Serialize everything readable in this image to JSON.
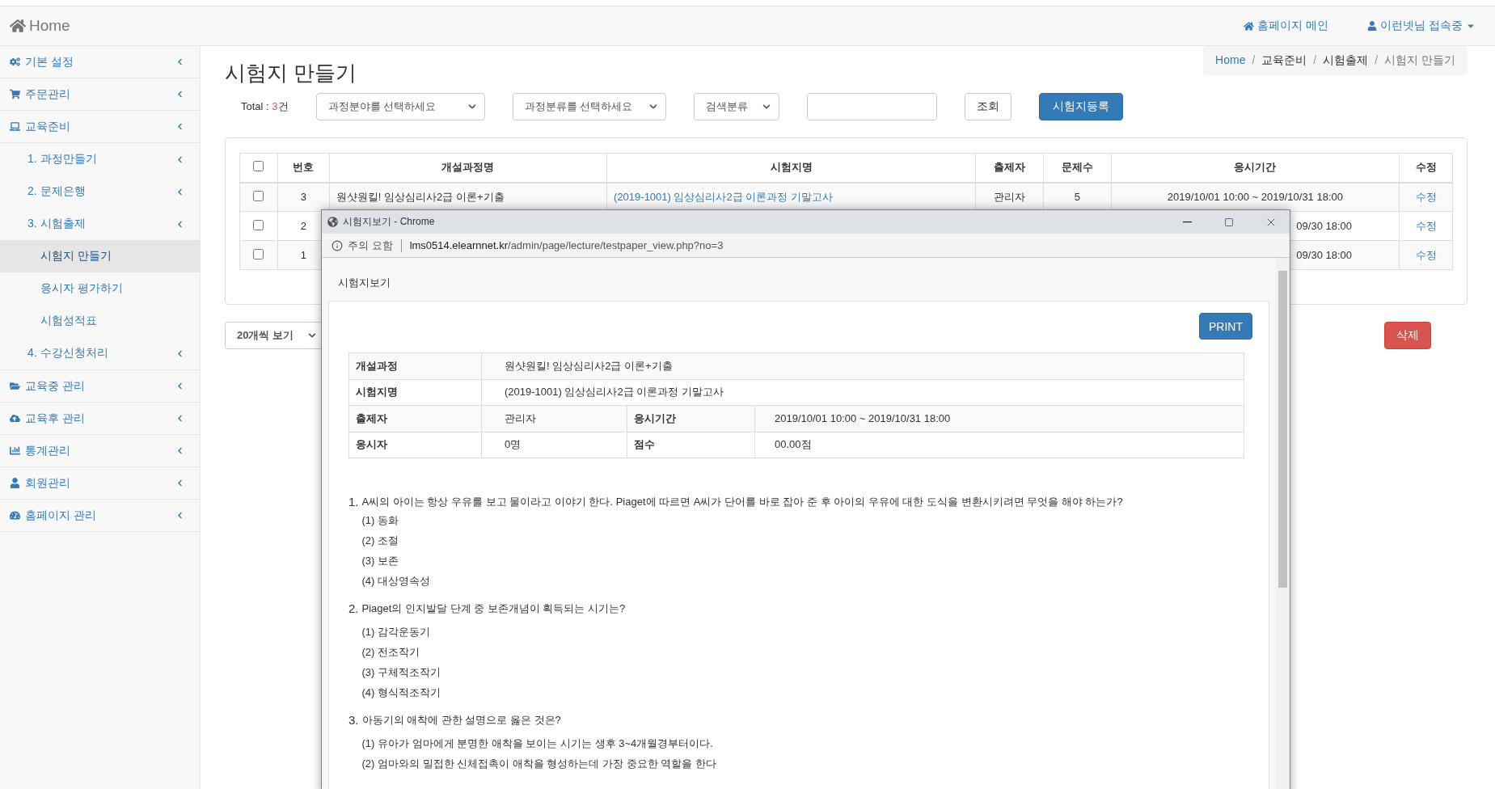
{
  "navbar": {
    "brand": "Home",
    "links": [
      {
        "label": "홈페이지 메인",
        "kind": "link"
      },
      {
        "label": "이런넷님 접속중",
        "kind": "dropdown"
      }
    ]
  },
  "sidebar": {
    "items": [
      {
        "label": "기본 설정"
      },
      {
        "label": "주문관리"
      },
      {
        "label": "교육준비",
        "children": [
          {
            "label": "1. 과정만들기",
            "has_caret": true,
            "selected": false
          },
          {
            "label": "2. 문제은행",
            "has_caret": true,
            "selected": false
          },
          {
            "label": "3. 시험출제",
            "has_caret": true,
            "selected": false,
            "children": [
              {
                "label": "시험지 만들기",
                "selected": true
              },
              {
                "label": "응시자 평가하기",
                "selected": false
              },
              {
                "label": "시험성적표",
                "selected": false
              }
            ]
          },
          {
            "label": "4. 수강신청처리",
            "has_caret": true,
            "selected": false
          }
        ]
      },
      {
        "label": "교육중 관리"
      },
      {
        "label": "교육후 관리"
      },
      {
        "label": "통계관리"
      },
      {
        "label": "회원관리"
      },
      {
        "label": "홈페이지 관리"
      }
    ]
  },
  "page": {
    "title": "시험지 만들기",
    "breadcrumb_separator": "/",
    "breadcrumb": [
      {
        "label": "Home",
        "kind": "link"
      },
      {
        "label": "교육준비",
        "kind": "text"
      },
      {
        "label": "시험출제",
        "kind": "text"
      },
      {
        "label": "시험지 만들기",
        "kind": "current"
      }
    ]
  },
  "toolbar": {
    "total_label": "Total : ",
    "total_count": "3",
    "total_unit": "건",
    "selects": [
      "과정분야를 선택하세요",
      "과정분류를 선택하세요",
      "검색분류"
    ],
    "search_button": "조회",
    "register_button": "시험지등록"
  },
  "table": {
    "header_checked": false,
    "columns": [
      "번호",
      "개설과정명",
      "시험지명",
      "출제자",
      "문제수",
      "응시기간",
      "수정"
    ],
    "rows": [
      {
        "checked": false,
        "no": "3",
        "course": "원샷원킬! 임상심리사2급 이론+기출",
        "paper": "(2019-1001) 임상심리사2급 이론과정 기말고사",
        "author": "관리자",
        "count": "5",
        "period": "2019/10/01 10:00 ~ 2019/10/31 18:00",
        "edit": "수정"
      },
      {
        "checked": false,
        "no": "2",
        "period": "09/30 18:00",
        "edit": "수정"
      },
      {
        "checked": false,
        "no": "1",
        "period": "09/30 18:00",
        "edit": "수정"
      }
    ]
  },
  "footer": {
    "page_size": "20개씩 보기",
    "delete_button": "삭제"
  },
  "popup": {
    "title": "시험지보기 - Chrome",
    "security": "주의 요함",
    "url_host": "lms0514.elearnnet.kr",
    "url_path": "/admin/page/lecture/testpaper_view.php?no=3",
    "heading": "시험지보기",
    "print_button": "PRINT",
    "info": {
      "course_label": "개설과정",
      "course": "원샷원킬! 임상심리사2급 이론+기출",
      "paper_label": "시험지명",
      "paper": "(2019-1001) 임상심리사2급 이론과정 기말고사",
      "author_label": "출제자",
      "author": "관리자",
      "period_label": "응시기간",
      "period": "2019/10/01 10:00 ~ 2019/10/31 18:00",
      "takers_label": "응시자",
      "takers": "0명",
      "score_label": "점수",
      "score": "00.00점"
    },
    "questions": [
      {
        "number": "1.",
        "text": "A씨의 아이는 항상 우유를 보고 물이라고 이야기 한다. Piaget에 따르면 A씨가 단어를 바로 잡아 준 후 아이의 우유에 대한 도식을 변환시키려면 무엇을 해야 하는가?",
        "options": [
          "(1) 동화",
          "(2) 조절",
          "(3) 보존",
          "(4) 대상영속성"
        ]
      },
      {
        "number": "2.",
        "text": "Piaget의 인지발달 단계 중 보존개념이 획득되는 시기는?",
        "options": [
          "(1) 감각운동기",
          "(2) 전조작기",
          "(3) 구체적조작기",
          "(4) 형식적조작기"
        ]
      },
      {
        "number": "3.",
        "text": "아동기의 애착에 관한 설명으로 옳은 것은?",
        "options": [
          "(1) 유아가 엄마에게 분명한 애착을 보이는 시기는 생후 3~4개월경부터이다.",
          "(2) 엄마와의 밀접한 신체접촉이 애착을 형성하는데 가장 중요한 역할을 한다"
        ]
      }
    ]
  }
}
